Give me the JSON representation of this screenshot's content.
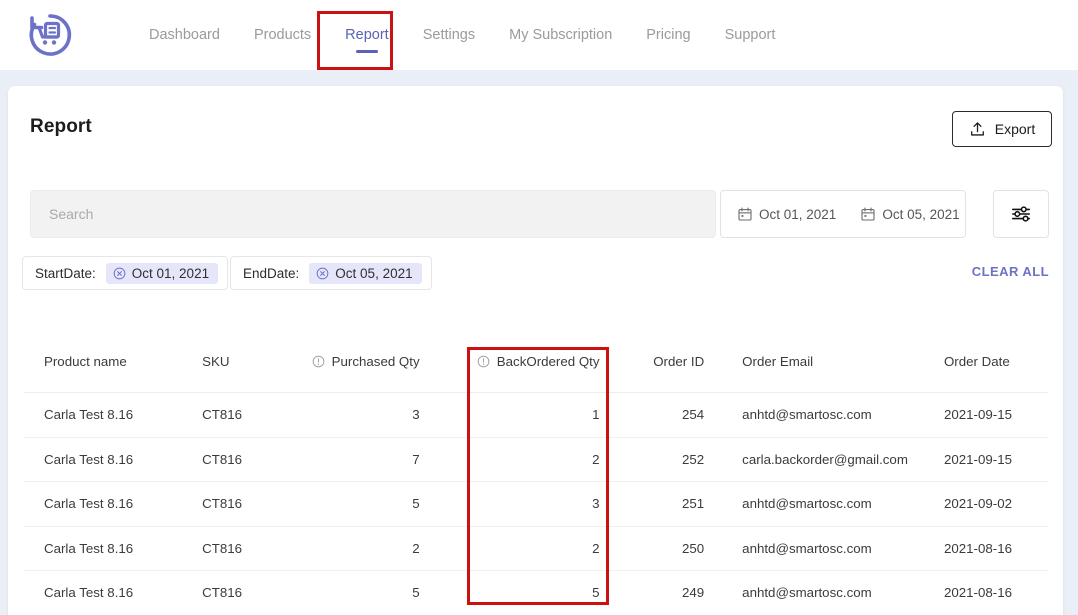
{
  "nav": {
    "logo_name": "return-cart-logo",
    "items": [
      {
        "label": "Dashboard",
        "active": false
      },
      {
        "label": "Products",
        "active": false
      },
      {
        "label": "Report",
        "active": true
      },
      {
        "label": "Settings",
        "active": false
      },
      {
        "label": "My Subscription",
        "active": false
      },
      {
        "label": "Pricing",
        "active": false
      },
      {
        "label": "Support",
        "active": false
      }
    ]
  },
  "header": {
    "title": "Report",
    "export_label": "Export",
    "export_icon": "upload-icon"
  },
  "filters": {
    "search_placeholder": "Search",
    "search_value": "",
    "date_from": "Oct 01, 2021",
    "date_to": "Oct 05, 2021",
    "date_icon": "calendar-icon",
    "filter_icon": "sliders-icon",
    "clear_all_label": "CLEAR ALL",
    "chips": [
      {
        "label": "StartDate:",
        "value": "Oct 01, 2021",
        "remove_icon": "circle-close-icon"
      },
      {
        "label": "EndDate:",
        "value": "Oct 05, 2021",
        "remove_icon": "circle-close-icon"
      }
    ]
  },
  "table": {
    "columns": [
      {
        "label": "Product name",
        "info": false
      },
      {
        "label": "SKU",
        "info": false
      },
      {
        "label": "Purchased Qty",
        "info": true
      },
      {
        "label": "BackOrdered Qty",
        "info": true
      },
      {
        "label": "Order ID",
        "info": false
      },
      {
        "label": "Order Email",
        "info": false
      },
      {
        "label": "Order Date",
        "info": false
      }
    ],
    "rows": [
      {
        "product": "Carla Test 8.16",
        "sku": "CT816",
        "purchased": "3",
        "backordered": "1",
        "order_id": "254",
        "email": "anhtd@smartosc.com",
        "date": "2021-09-15"
      },
      {
        "product": "Carla Test 8.16",
        "sku": "CT816",
        "purchased": "7",
        "backordered": "2",
        "order_id": "252",
        "email": "carla.backorder@gmail.com",
        "date": "2021-09-15"
      },
      {
        "product": "Carla Test 8.16",
        "sku": "CT816",
        "purchased": "5",
        "backordered": "3",
        "order_id": "251",
        "email": "anhtd@smartosc.com",
        "date": "2021-09-02"
      },
      {
        "product": "Carla Test 8.16",
        "sku": "CT816",
        "purchased": "2",
        "backordered": "2",
        "order_id": "250",
        "email": "anhtd@smartosc.com",
        "date": "2021-08-16"
      },
      {
        "product": "Carla Test 8.16",
        "sku": "CT816",
        "purchased": "5",
        "backordered": "5",
        "order_id": "249",
        "email": "anhtd@smartosc.com",
        "date": "2021-08-16"
      }
    ]
  },
  "annotations": {
    "color": "#cc1111",
    "boxes": [
      "report-tab",
      "backordered-qty-column"
    ]
  },
  "colors": {
    "accent": "#5b62b8",
    "chip_bg": "#e6e6fa",
    "page_bg": "#e9eef7",
    "link": "#6c73c4"
  }
}
